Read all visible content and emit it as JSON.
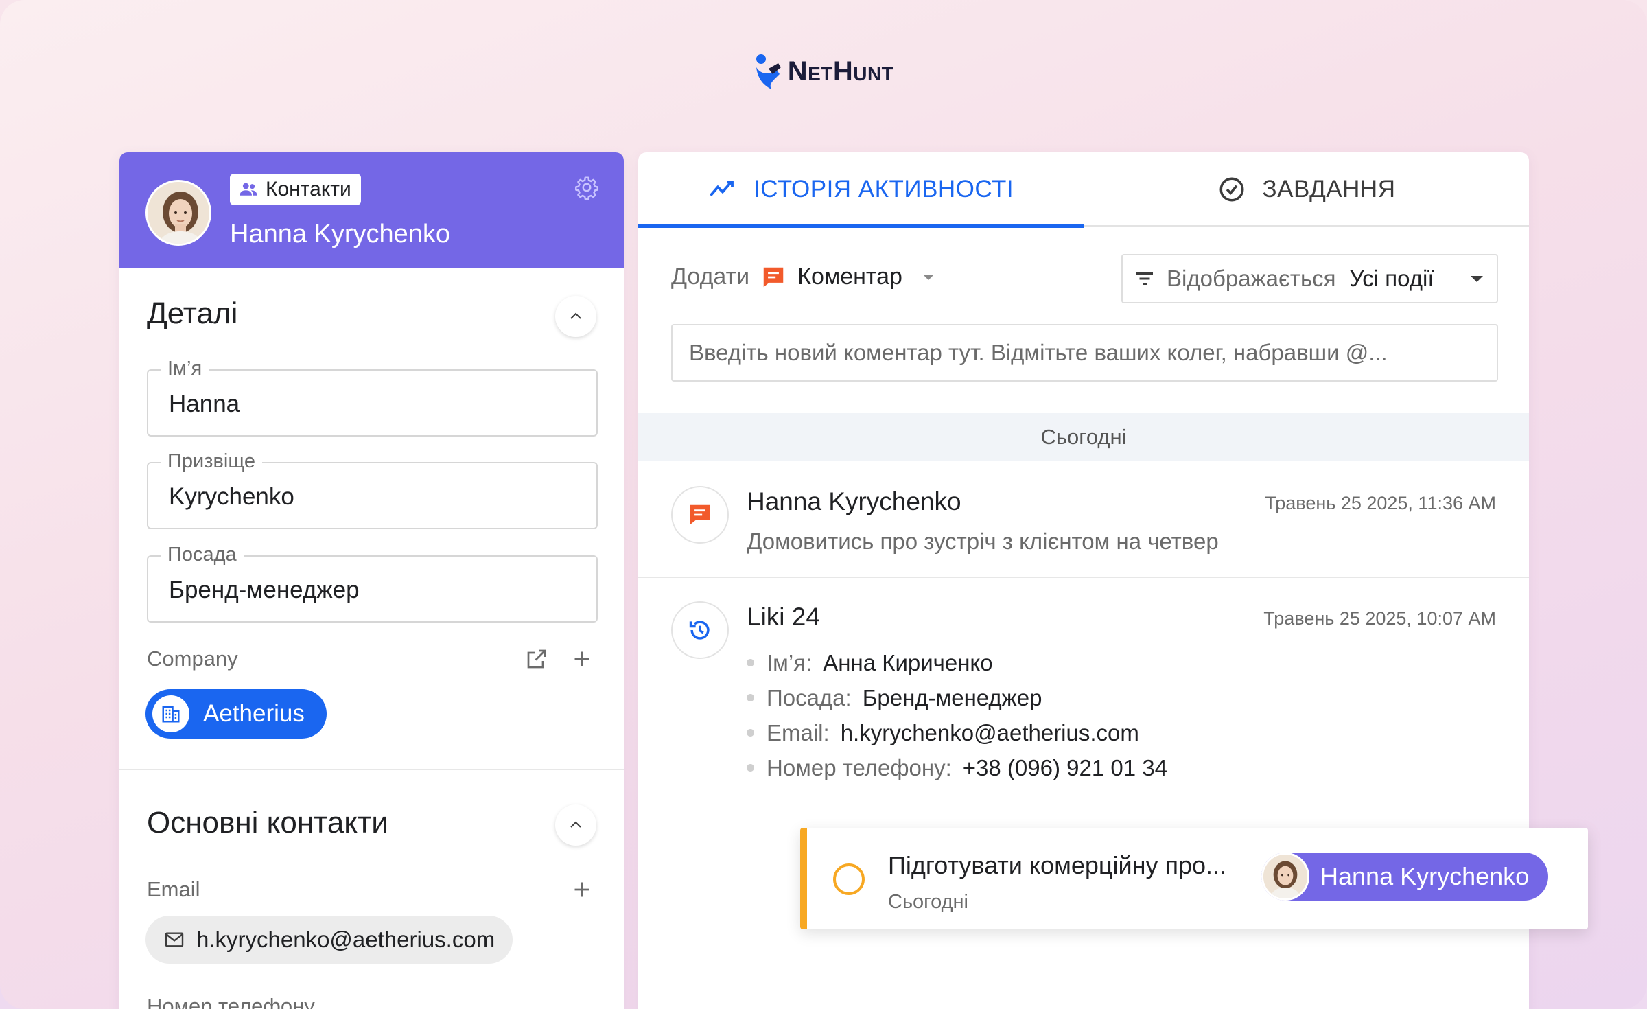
{
  "brand": {
    "logo_text": "NetHunt"
  },
  "contact": {
    "badge_label": "Контакти",
    "name": "Hanna Kyrychenko"
  },
  "details": {
    "title": "Деталі",
    "fields": [
      {
        "label": "Ім’я",
        "value": "Hanna"
      },
      {
        "label": "Призвіще",
        "value": "Kyrychenko"
      },
      {
        "label": "Посада",
        "value": "Бренд-менеджер"
      }
    ],
    "company_label": "Company",
    "company_value": "Aetherius"
  },
  "main_contacts": {
    "title": "Основні контакти",
    "email_label": "Email",
    "email_value": "h.kyrychenko@aetherius.com",
    "phone_label": "Номер телефону"
  },
  "tabs": [
    {
      "label": "ІСТОРІЯ АКТИВНОСТІ",
      "active": true,
      "icon": "trend-line-icon"
    },
    {
      "label": "ЗАВДАННЯ",
      "active": false,
      "icon": "check-circle-icon"
    }
  ],
  "composer": {
    "add_label": "Додати",
    "add_type": "Коментар",
    "filter_label": "Відображається",
    "filter_value": "Усі події",
    "placeholder": "Введіть новий коментар тут. Відмітьте ваших колег, набравши @..."
  },
  "feed": {
    "day_label": "Сьогодні",
    "items": [
      {
        "icon": "comment-icon",
        "title": "Hanna Kyrychenko",
        "time": "Травень 25 2025, 11:36 AM",
        "text": "Домовитись про зустріч з клієнтом на четвер"
      },
      {
        "icon": "history-icon",
        "title": "Liki 24",
        "time": "Травень 25 2025, 10:07 AM",
        "changes": [
          {
            "key": "Ім’я:",
            "value": "Анна Кириченко"
          },
          {
            "key": "Посада:",
            "value": "Бренд-менеджер"
          },
          {
            "key": "Email:",
            "value": "h.kyrychenko@aetherius.com"
          },
          {
            "key": "Номер телефону:",
            "value": "+38 (096) 921 01 34"
          }
        ]
      }
    ]
  },
  "task": {
    "title": "Підготувати комерційну про...",
    "date": "Сьогодні",
    "assignee": "Hanna Kyrychenko"
  },
  "colors": {
    "header_purple": "#7467e6",
    "accent_blue": "#1a66f0",
    "comment_orange": "#f25a2b",
    "task_orange": "#f7a823"
  }
}
